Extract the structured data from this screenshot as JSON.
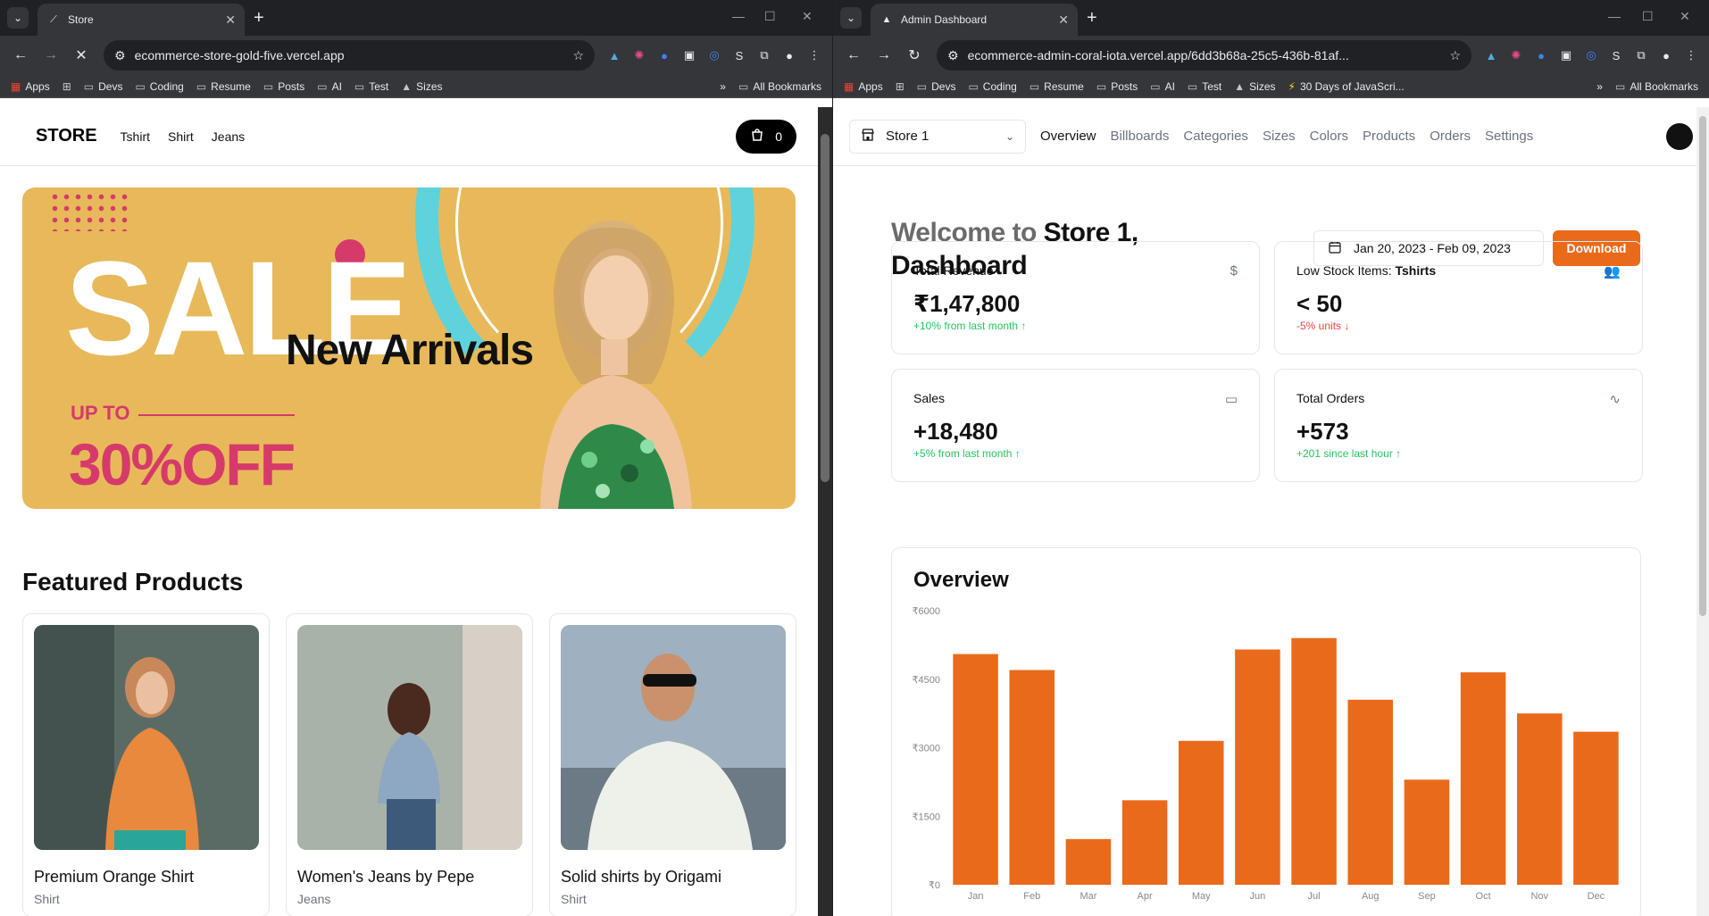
{
  "left_window": {
    "tab_title": "Store",
    "url": "ecommerce-store-gold-five.vercel.app",
    "bookmarks": [
      "Apps",
      "Devs",
      "Coding",
      "Resume",
      "Posts",
      "AI",
      "Test",
      "Sizes"
    ],
    "all_bookmarks": "All Bookmarks",
    "store": {
      "logo": "STORE",
      "nav": [
        "Tshirt",
        "Shirt",
        "Jeans"
      ],
      "cart_count": "0",
      "hero": {
        "sale": "SALE",
        "headline": "New Arrivals",
        "up_to": "UP TO",
        "discount": "30%OFF"
      },
      "featured_title": "Featured Products",
      "products": [
        {
          "name": "Premium Orange Shirt",
          "category": "Shirt"
        },
        {
          "name": "Women's Jeans by Pepe",
          "category": "Jeans"
        },
        {
          "name": "Solid shirts by Origami",
          "category": "Shirt"
        }
      ]
    }
  },
  "right_window": {
    "tab_title": "Admin Dashboard",
    "url": "ecommerce-admin-coral-iota.vercel.app/6dd3b68a-25c5-436b-81af...",
    "bookmarks": [
      "Apps",
      "Devs",
      "Coding",
      "Resume",
      "Posts",
      "AI",
      "Test",
      "Sizes",
      "30 Days of JavaScri..."
    ],
    "all_bookmarks": "All Bookmarks",
    "admin": {
      "store_switcher": "Store 1",
      "nav": [
        {
          "label": "Overview",
          "active": true
        },
        {
          "label": "Billboards",
          "active": false
        },
        {
          "label": "Categories",
          "active": false
        },
        {
          "label": "Sizes",
          "active": false
        },
        {
          "label": "Colors",
          "active": false
        },
        {
          "label": "Products",
          "active": false
        },
        {
          "label": "Orders",
          "active": false
        },
        {
          "label": "Settings",
          "active": false
        }
      ],
      "welcome_prefix": "Welcome to",
      "welcome_store": "Store 1,",
      "welcome_line2": "Dashboard",
      "date_range": "Jan 20, 2023 - Feb 09, 2023",
      "download_label": "Download",
      "stats": [
        {
          "label": "Total Revenue",
          "value": "₹1,47,800",
          "sub": "+10% from last month",
          "trend": "up",
          "icon": "dollar-icon"
        },
        {
          "label": "Low Stock Items: ",
          "label_bold": "Tshirts",
          "value": "< 50",
          "sub": "-5% units",
          "trend": "down",
          "icon": "users-icon"
        },
        {
          "label": "Sales",
          "value": "+18,480",
          "sub": "+5% from last month",
          "trend": "up",
          "icon": "credit-card-icon"
        },
        {
          "label": "Total Orders",
          "value": "+573",
          "sub": "+201 since last hour",
          "trend": "up",
          "icon": "activity-icon"
        }
      ],
      "overview_title": "Overview"
    }
  },
  "colors": {
    "accent": "#ea6a1b",
    "hero_bg": "#e8b95a",
    "sale_pink": "#d63a6b",
    "cyan_arc": "#5fd3dc"
  },
  "chart_data": {
    "type": "bar",
    "categories": [
      "Jan",
      "Feb",
      "Mar",
      "Apr",
      "May",
      "Jun",
      "Jul",
      "Aug",
      "Sep",
      "Oct",
      "Nov",
      "Dec"
    ],
    "values": [
      5050,
      4700,
      1000,
      1850,
      3150,
      5150,
      5400,
      4050,
      2300,
      4650,
      3750,
      3350
    ],
    "yticks": [
      "₹0",
      "₹1500",
      "₹3000",
      "₹4500",
      "₹6000"
    ],
    "ytick_values": [
      0,
      1500,
      3000,
      4500,
      6000
    ],
    "ylim": [
      0,
      6000
    ],
    "color": "#ea6a1b",
    "title": "Overview",
    "xlabel": "",
    "ylabel": ""
  }
}
